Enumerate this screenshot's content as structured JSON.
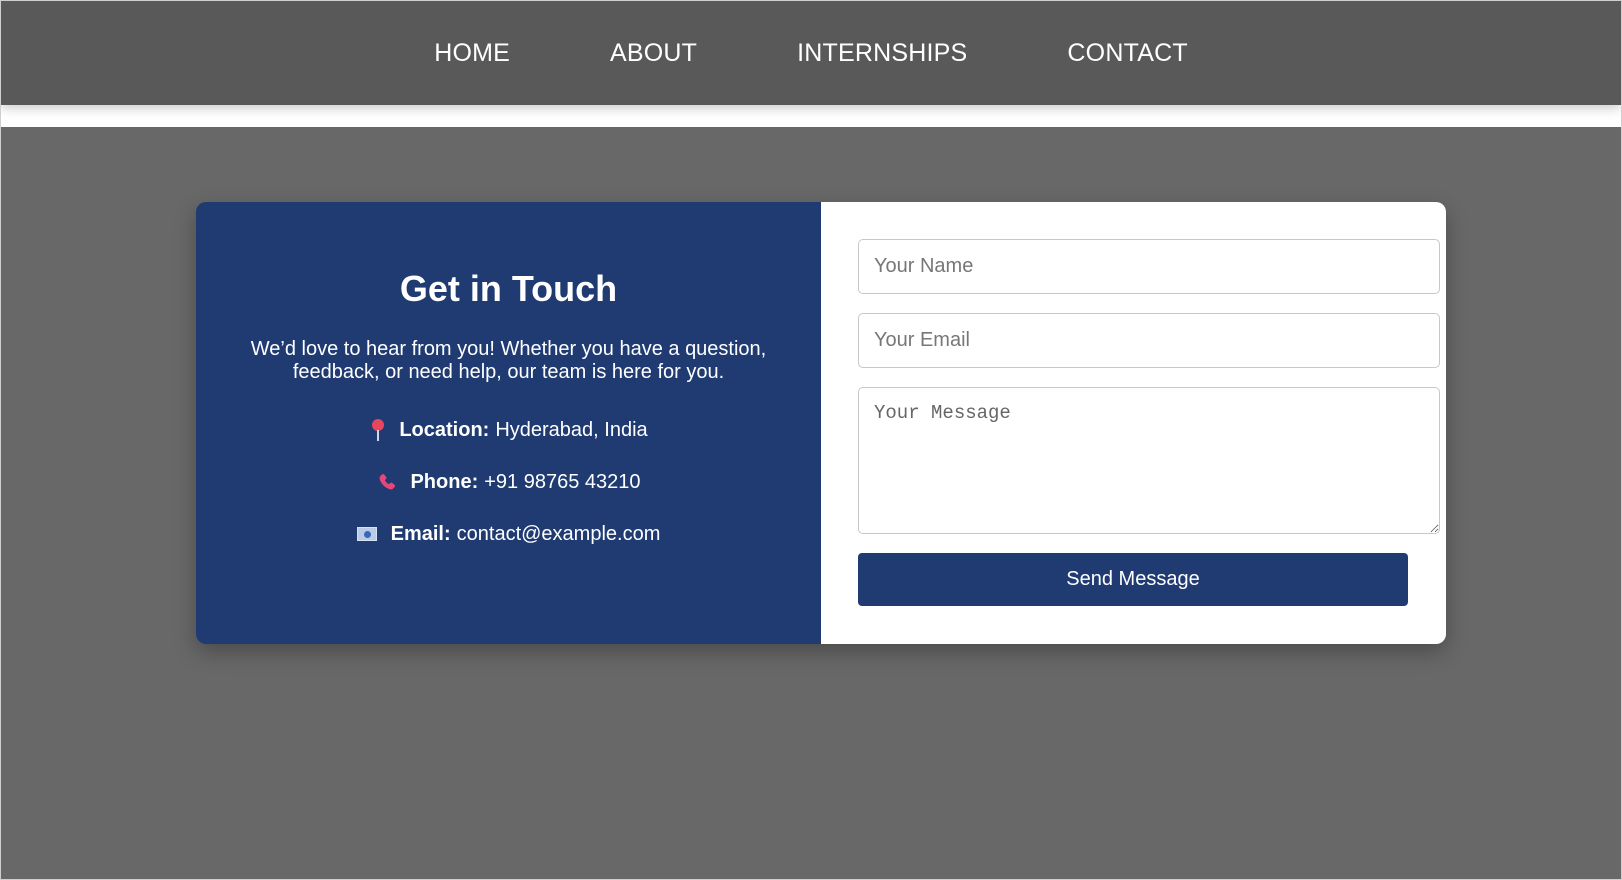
{
  "nav": {
    "items": [
      {
        "label": "HOME"
      },
      {
        "label": "ABOUT"
      },
      {
        "label": "INTERNSHIPS"
      },
      {
        "label": "CONTACT"
      }
    ]
  },
  "contact": {
    "title": "Get in Touch",
    "description": "We’d love to hear from you! Whether you have a question, feedback, or need help, our team is here for you.",
    "location": {
      "icon": "map-pin-icon",
      "label": "Location:",
      "value": "Hyderabad, India"
    },
    "phone": {
      "icon": "phone-icon",
      "label": "Phone:",
      "value": "+91 98765 43210"
    },
    "email": {
      "icon": "email-icon",
      "label": "Email:",
      "value": "contact@example.com"
    }
  },
  "form": {
    "name_placeholder": "Your Name",
    "email_placeholder": "Your Email",
    "message_placeholder": "Your Message",
    "submit_label": "Send Message"
  },
  "colors": {
    "nav_bg": "#595959",
    "page_bg": "#686868",
    "accent_blue": "#1f3b72",
    "white": "#ffffff"
  }
}
